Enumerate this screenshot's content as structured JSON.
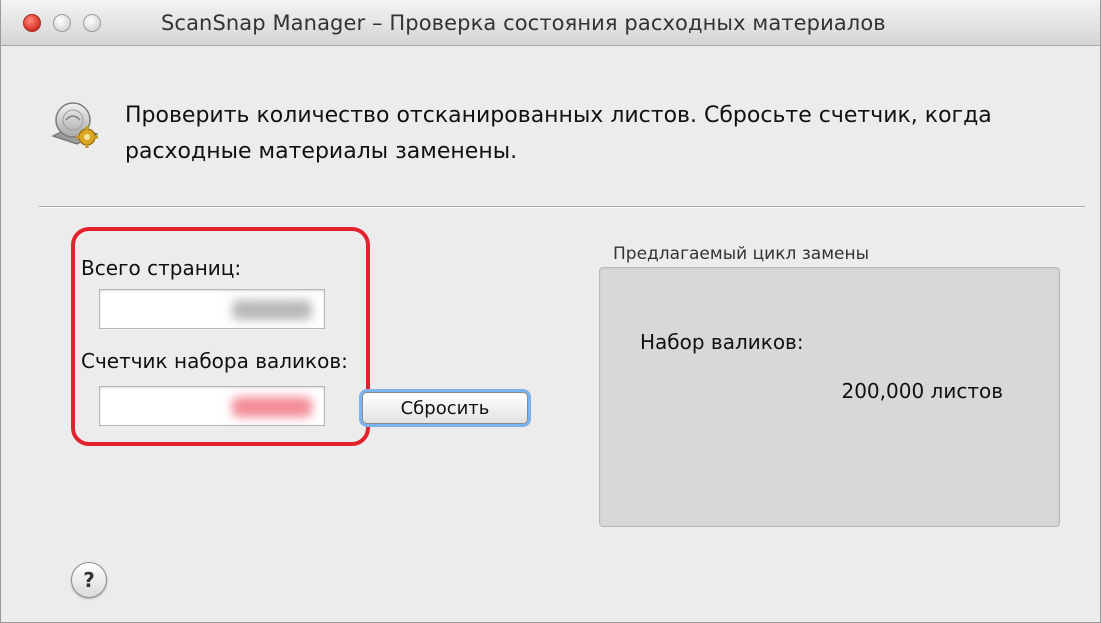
{
  "window": {
    "title": "ScanSnap Manager – Проверка состояния расходных материалов"
  },
  "header": {
    "icon": "scanner-gear-icon",
    "message": "Проверить количество отсканированных листов. Сбросьте счетчик, когда расходные материалы заменены."
  },
  "counters": {
    "total_pages_label": "Всего страниц:",
    "total_pages_value": "",
    "roller_counter_label": "Счетчик набора валиков:",
    "roller_counter_value": "",
    "reset_button_label": "Сбросить"
  },
  "replacement_cycle": {
    "group_title": "Предлагаемый цикл замены",
    "rollers_label": "Набор валиков:",
    "rollers_value": "200,000 листов"
  },
  "help": {
    "icon": "question-mark-icon",
    "label": "?"
  },
  "colors": {
    "highlight": "#e2232d",
    "close_button": "#d9352a",
    "focus_ring": "#7bb3ee"
  }
}
